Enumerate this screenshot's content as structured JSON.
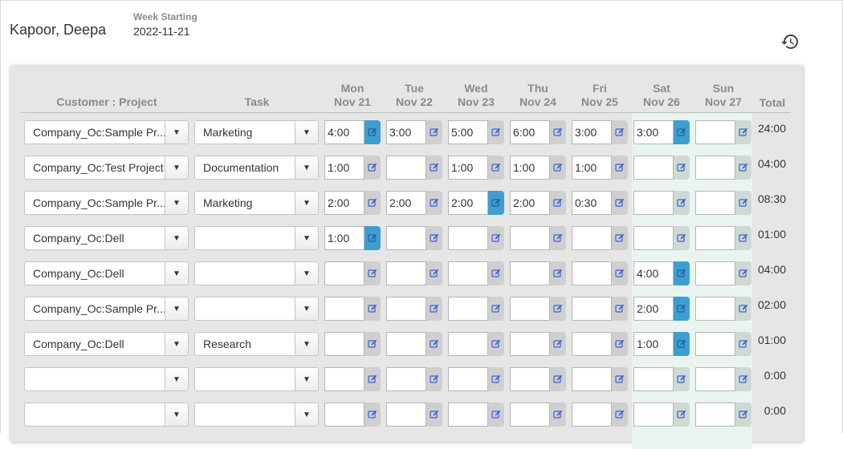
{
  "header": {
    "employee_name": "Kapoor, Deepa",
    "week_label": "Week Starting",
    "week_value": "2022-11-21",
    "history_icon": "history-icon"
  },
  "columns": {
    "customer_project": "Customer : Project",
    "task": "Task",
    "total": "Total",
    "days": [
      {
        "day": "Mon",
        "date": "Nov 21"
      },
      {
        "day": "Tue",
        "date": "Nov 22"
      },
      {
        "day": "Wed",
        "date": "Nov 23"
      },
      {
        "day": "Thu",
        "date": "Nov 24"
      },
      {
        "day": "Fri",
        "date": "Nov 25"
      },
      {
        "day": "Sat",
        "date": "Nov 26"
      },
      {
        "day": "Sun",
        "date": "Nov 27"
      }
    ]
  },
  "colors": {
    "active_edit": "#3d9fd0",
    "edit_icon": "#3a5fd0",
    "weekend_bg": "#e9f4ef"
  },
  "rows": [
    {
      "project": "Company_Oc:Sample Pr...",
      "task": "Marketing",
      "hours": [
        "4:00",
        "3:00",
        "5:00",
        "6:00",
        "3:00",
        "3:00",
        ""
      ],
      "active": [
        true,
        false,
        false,
        false,
        false,
        true,
        false
      ],
      "total": "24:00"
    },
    {
      "project": "Company_Oc:Test Project",
      "task": "Documentation",
      "hours": [
        "1:00",
        "",
        "1:00",
        "1:00",
        "1:00",
        "",
        ""
      ],
      "active": [
        false,
        false,
        false,
        false,
        false,
        false,
        false
      ],
      "total": "04:00"
    },
    {
      "project": "Company_Oc:Sample Pr...",
      "task": "Marketing",
      "hours": [
        "2:00",
        "2:00",
        "2:00",
        "2:00",
        "0:30",
        "",
        ""
      ],
      "active": [
        false,
        false,
        true,
        false,
        false,
        false,
        false
      ],
      "total": "08:30"
    },
    {
      "project": "Company_Oc:Dell",
      "task": "",
      "hours": [
        "1:00",
        "",
        "",
        "",
        "",
        "",
        ""
      ],
      "active": [
        true,
        false,
        false,
        false,
        false,
        false,
        false
      ],
      "total": "01:00"
    },
    {
      "project": "Company_Oc:Dell",
      "task": "",
      "hours": [
        "",
        "",
        "",
        "",
        "",
        "4:00",
        ""
      ],
      "active": [
        false,
        false,
        false,
        false,
        false,
        true,
        false
      ],
      "total": "04:00"
    },
    {
      "project": "Company_Oc:Sample Pr...",
      "task": "",
      "hours": [
        "",
        "",
        "",
        "",
        "",
        "2:00",
        ""
      ],
      "active": [
        false,
        false,
        false,
        false,
        false,
        true,
        false
      ],
      "total": "02:00"
    },
    {
      "project": "Company_Oc:Dell",
      "task": "Research",
      "hours": [
        "",
        "",
        "",
        "",
        "",
        "1:00",
        ""
      ],
      "active": [
        false,
        false,
        false,
        false,
        false,
        true,
        false
      ],
      "total": "01:00"
    },
    {
      "project": "",
      "task": "",
      "hours": [
        "",
        "",
        "",
        "",
        "",
        "",
        ""
      ],
      "active": [
        false,
        false,
        false,
        false,
        false,
        false,
        false
      ],
      "total": "0:00"
    },
    {
      "project": "",
      "task": "",
      "hours": [
        "",
        "",
        "",
        "",
        "",
        "",
        ""
      ],
      "active": [
        false,
        false,
        false,
        false,
        false,
        false,
        false
      ],
      "total": "0:00"
    }
  ]
}
